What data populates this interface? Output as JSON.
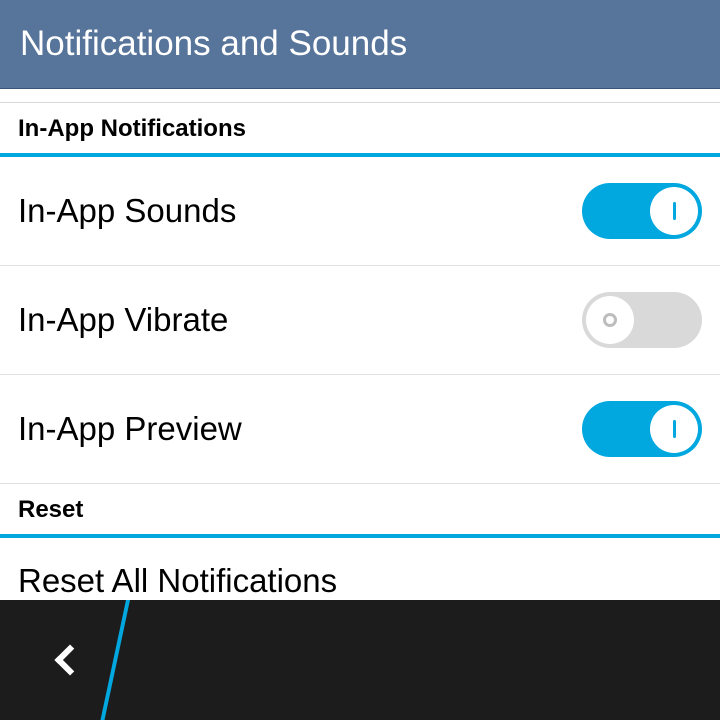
{
  "header": {
    "title": "Notifications and Sounds"
  },
  "sections": {
    "inapp": {
      "header": "In-App Notifications",
      "sounds": {
        "label": "In-App Sounds",
        "state": "on"
      },
      "vibrate": {
        "label": "In-App Vibrate",
        "state": "off"
      },
      "preview": {
        "label": "In-App Preview",
        "state": "on"
      }
    },
    "reset": {
      "header": "Reset",
      "reset_all": {
        "label": "Reset All Notifications"
      }
    }
  },
  "colors": {
    "accent": "#00a8df",
    "header_bg": "#57749a"
  }
}
